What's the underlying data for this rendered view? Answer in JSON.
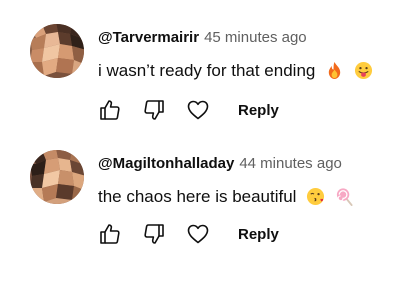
{
  "comments": [
    {
      "author": "@Tarvermairir",
      "time": "45 minutes ago",
      "text": "i wasn’t ready for that ending",
      "emojis": [
        "fire-emoji",
        "tongue-out-face-emoji"
      ],
      "reply_label": "Reply"
    },
    {
      "author": "@Magiltonhalladay",
      "time": "44 minutes ago",
      "text": "the chaos here is beautiful",
      "emojis": [
        "face-blowing-kiss-emoji",
        "lollipop-emoji"
      ],
      "reply_label": "Reply"
    }
  ],
  "icons": [
    "like-icon",
    "dislike-icon",
    "heart-icon"
  ],
  "colors": {
    "author": "#0f0f0f",
    "timestamp": "#606060",
    "text": "#0f0f0f",
    "icon_stroke": "#0f0f0f",
    "background": "#ffffff"
  }
}
